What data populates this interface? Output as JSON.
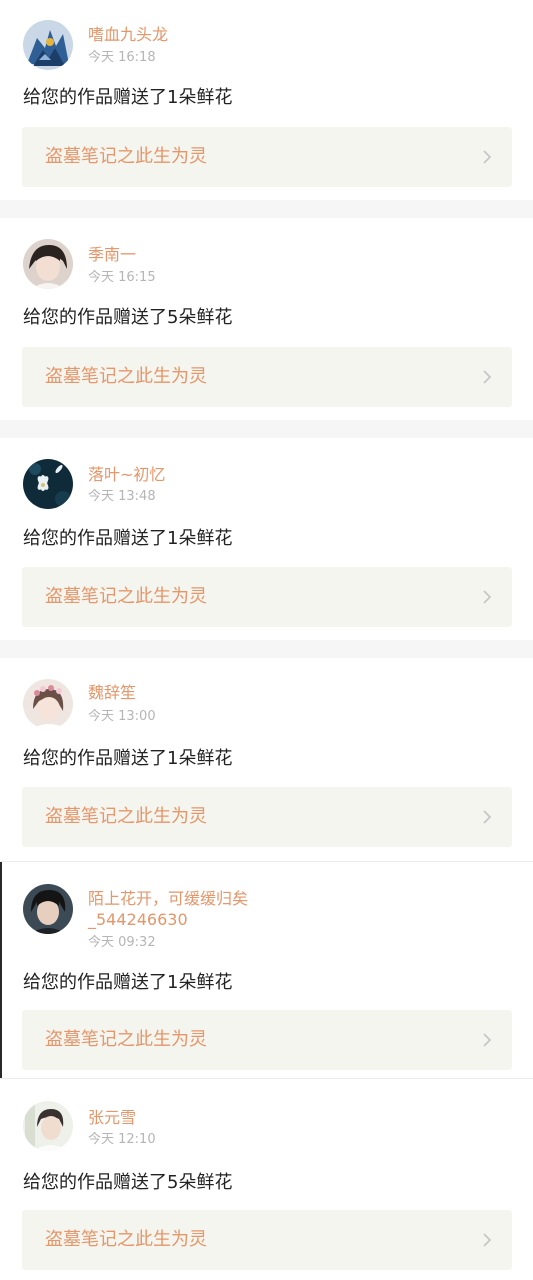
{
  "notifications": [
    {
      "user": "嗜血九头龙",
      "time": "今天 16:18",
      "message": "给您的作品赠送了1朵鲜花",
      "work_title": "盗墓笔记之此生为灵",
      "avatar_icon": "avatar-blue-dragon"
    },
    {
      "user": "季南一",
      "time": "今天 16:15",
      "message": "给您的作品赠送了5朵鲜花",
      "work_title": "盗墓笔记之此生为灵",
      "avatar_icon": "avatar-portrait-dark-hair"
    },
    {
      "user": "落叶~初忆",
      "time": "今天 13:48",
      "message": "给您的作品赠送了1朵鲜花",
      "work_title": "盗墓笔记之此生为灵",
      "avatar_icon": "avatar-white-flower-night"
    },
    {
      "user": "魏辞笙",
      "time": "今天 13:00",
      "message": "给您的作品赠送了1朵鲜花",
      "work_title": "盗墓笔记之此生为灵",
      "avatar_icon": "avatar-girl-flower-crown"
    },
    {
      "user": "陌上花开，可缓缓归矣",
      "user_line2": "_544246630",
      "time": "今天 09:32",
      "message": "给您的作品赠送了1朵鲜花",
      "work_title": "盗墓笔记之此生为灵",
      "avatar_icon": "avatar-boy-dark"
    },
    {
      "user": "张元雪",
      "time": "今天 12:10",
      "message": "给您的作品赠送了5朵鲜花",
      "work_title": "盗墓笔记之此生为灵",
      "avatar_icon": "avatar-boy-light"
    }
  ],
  "colors": {
    "username": "#e5966a",
    "work_title": "#e5966a",
    "time": "#b5b5b5",
    "message": "#222222",
    "work_card_bg": "#f5f5ef",
    "separator": "#f6f6f6"
  }
}
